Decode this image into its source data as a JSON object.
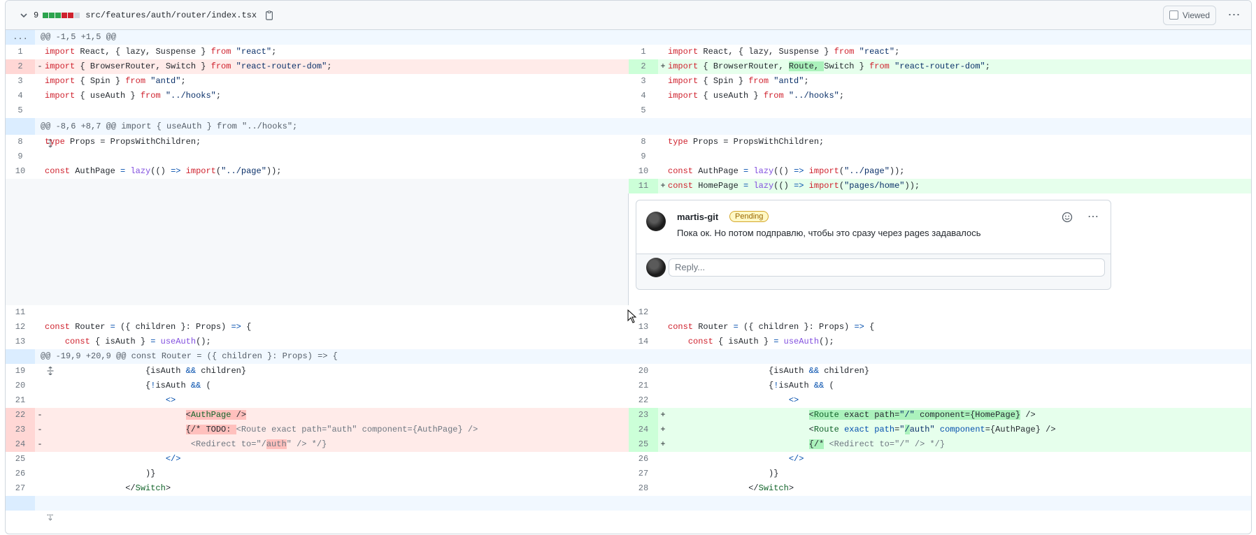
{
  "file": {
    "changes_count": "9",
    "diffstat": [
      "#2da44e",
      "#2da44e",
      "#2da44e",
      "#cf222e",
      "#cf222e",
      "#d0d7de"
    ],
    "filename": "src/features/auth/router/index.tsx",
    "viewed_label": "Viewed"
  },
  "hunks": {
    "h1": "@@ -1,5 +1,5 @@",
    "h2": "@@ -8,6 +8,7 @@ import { useAuth } from \"../hooks\";",
    "h3": "@@ -19,9 +20,9 @@ const Router = ({ children }: Props) => {",
    "expander_dots": "..."
  },
  "lines": {
    "l1": "1",
    "r1": "1",
    "l2": "2",
    "r2": "2",
    "l3": "3",
    "r3": "3",
    "l4": "4",
    "r4": "4",
    "l5": "5",
    "r5": "5",
    "l8": "8",
    "r8": "8",
    "l9": "9",
    "r9": "9",
    "l10": "10",
    "r10": "10",
    "r11": "11",
    "l11": "11",
    "r12": "12",
    "l12": "12",
    "r13": "13",
    "l13": "13",
    "r14": "14",
    "l19": "19",
    "r20": "20",
    "l20": "20",
    "r21": "21",
    "l21": "21",
    "r22": "22",
    "l22": "22",
    "r23": "23",
    "l23": "23",
    "r24": "24",
    "l24": "24",
    "r25": "25",
    "l25": "25",
    "r26": "26",
    "l26": "26",
    "r27": "27",
    "l27": "27",
    "r28": "28"
  },
  "comment": {
    "author": "martis-git",
    "badge": "Pending",
    "body": "Пока ок. Но потом подправлю, чтобы это сразу через pages задавалось",
    "reply_placeholder": "Reply..."
  }
}
